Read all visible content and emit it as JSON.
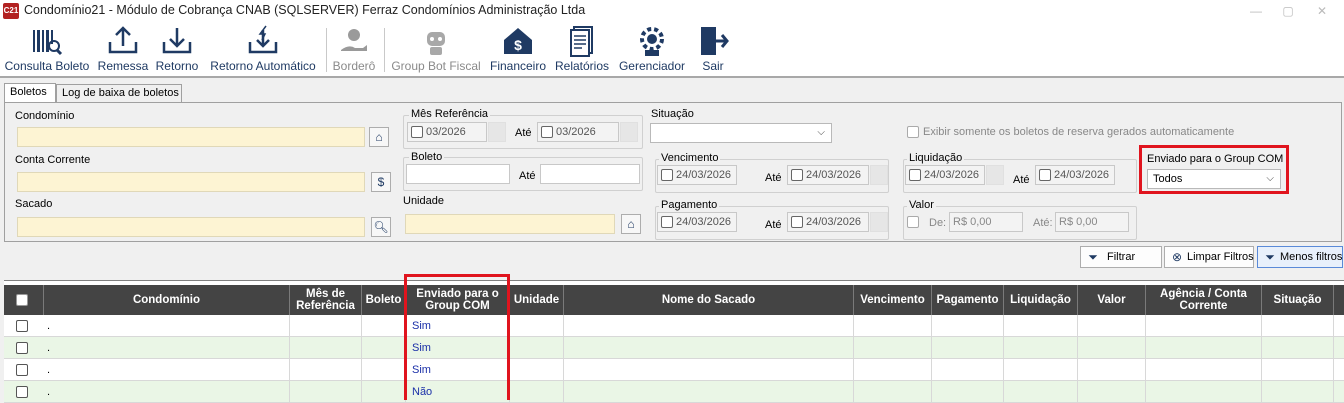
{
  "window": {
    "title": "Condomínio21 - Módulo de Cobrança CNAB (SQLSERVER)  Ferraz Condomínios Administração Ltda",
    "app_icon_text": "C21"
  },
  "toolbar": {
    "items": [
      {
        "label": "Consulta Boleto",
        "icon": "barcode-search-icon"
      },
      {
        "label": "Remessa",
        "icon": "upload-tray-icon"
      },
      {
        "label": "Retorno",
        "icon": "download-tray-icon"
      },
      {
        "label": "Retorno Automático",
        "icon": "auto-return-icon"
      },
      {
        "label": "Borderô",
        "icon": "money-hand-icon"
      },
      {
        "label": "Group Bot Fiscal",
        "icon": "robot-icon"
      },
      {
        "label": "Financeiro",
        "icon": "house-dollar-icon"
      },
      {
        "label": "Relatórios",
        "icon": "report-icon"
      },
      {
        "label": "Gerenciador",
        "icon": "manager-gear-icon"
      },
      {
        "label": "Sair",
        "icon": "exit-door-icon"
      }
    ]
  },
  "tabs": [
    {
      "label": "Boletos",
      "active": true
    },
    {
      "label": "Log de baixa de boletos",
      "active": false
    }
  ],
  "filters": {
    "condominio_label": "Condomínio",
    "conta_corrente_label": "Conta Corrente",
    "sacado_label": "Sacado",
    "mes_referencia_label": "Mês Referência",
    "mes_from": "03/2026",
    "mes_to": "03/2026",
    "ate": "Até",
    "boleto_label": "Boleto",
    "unidade_label": "Unidade",
    "situacao_label": "Situação",
    "vencimento_label": "Vencimento",
    "venc_from": "24/03/2026",
    "venc_to": "24/03/2026",
    "pagamento_label": "Pagamento",
    "pag_from": "24/03/2026",
    "pag_to": "24/03/2026",
    "liquidacao_label": "Liquidação",
    "liq_from": "24/03/2026",
    "liq_to": "24/03/2026",
    "valor_label": "Valor",
    "valor_de_label": "De:",
    "valor_de": "R$ 0,00",
    "valor_ate_label": "Até:",
    "valor_ate": "R$ 0,00",
    "reserva_label": "Exibir somente os boletos de reserva gerados automaticamente",
    "group_com_label": "Enviado para o Group COM",
    "group_com_value": "Todos"
  },
  "actions": {
    "filtrar": "Filtrar",
    "limpar": "Limpar Filtros",
    "menos": "Menos filtros"
  },
  "grid": {
    "columns": [
      "Condomínio",
      "Mês de Referência",
      "Boleto",
      "Enviado para o Group COM",
      "Unidade",
      "Nome do Sacado",
      "Vencimento",
      "Pagamento",
      "Liquidação",
      "Valor",
      "Agência / Conta Corrente",
      "Situação"
    ],
    "rows": [
      {
        "condominio": ".",
        "enviado": "Sim"
      },
      {
        "condominio": ".",
        "enviado": "Sim"
      },
      {
        "condominio": ".",
        "enviado": "Sim"
      },
      {
        "condominio": ".",
        "enviado": "Não"
      }
    ]
  },
  "colors": {
    "highlight": "#e0141e",
    "header_bg": "#444444",
    "alt_row": "#eaf6e6",
    "input_yellow": "#fdf4d3"
  }
}
